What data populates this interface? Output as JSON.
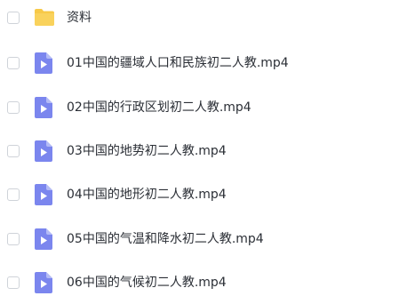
{
  "files": [
    {
      "name": "资料",
      "type": "folder",
      "icon": "folder-icon"
    },
    {
      "name": "01中国的疆域人口和民族初二人教.mp4",
      "type": "video",
      "icon": "video-file-icon"
    },
    {
      "name": "02中国的行政区划初二人教.mp4",
      "type": "video",
      "icon": "video-file-icon"
    },
    {
      "name": "03中国的地势初二人教.mp4",
      "type": "video",
      "icon": "video-file-icon"
    },
    {
      "name": "04中国的地形初二人教.mp4",
      "type": "video",
      "icon": "video-file-icon"
    },
    {
      "name": "05中国的气温和降水初二人教.mp4",
      "type": "video",
      "icon": "video-file-icon"
    },
    {
      "name": "06中国的气候初二人教.mp4",
      "type": "video",
      "icon": "video-file-icon"
    }
  ],
  "colors": {
    "folder": "#f7c948",
    "video_file": "#7b86ee",
    "video_file_fold": "#b4bbf6",
    "text": "#2b2f36",
    "checkbox_border": "#cfd3d9"
  }
}
